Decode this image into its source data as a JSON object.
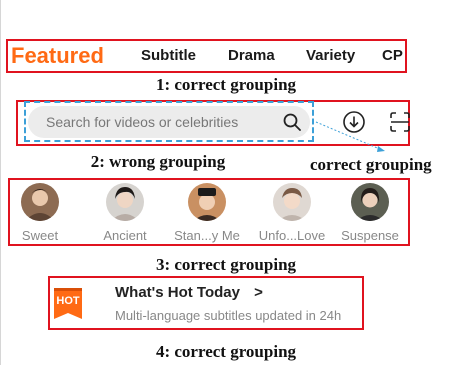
{
  "tabs": {
    "items": [
      "Featured",
      "Subtitle",
      "Drama",
      "Variety",
      "CP"
    ]
  },
  "captions": {
    "c1": "1: correct grouping",
    "c2_wrong": "2: wrong grouping",
    "c2_correct": "correct grouping",
    "c3": "3: correct grouping",
    "c4": "4: correct grouping"
  },
  "search": {
    "placeholder": "Search for videos or celebrities"
  },
  "actors": [
    "Sweet",
    "Ancient",
    "Stan...y Me",
    "Unfo...Love",
    "Suspense"
  ],
  "hot": {
    "badge": "HOT",
    "title": "What's Hot Today",
    "chevron": ">",
    "subtitle": "Multi-language subtitles updated in 24h"
  },
  "colors": {
    "accent": "#ff6a14",
    "annotation_red": "#e0131f",
    "annotation_blue": "#3ca0d8"
  },
  "icons": [
    "search-icon",
    "download-icon",
    "scan-icon",
    "chevron-right-icon"
  ]
}
